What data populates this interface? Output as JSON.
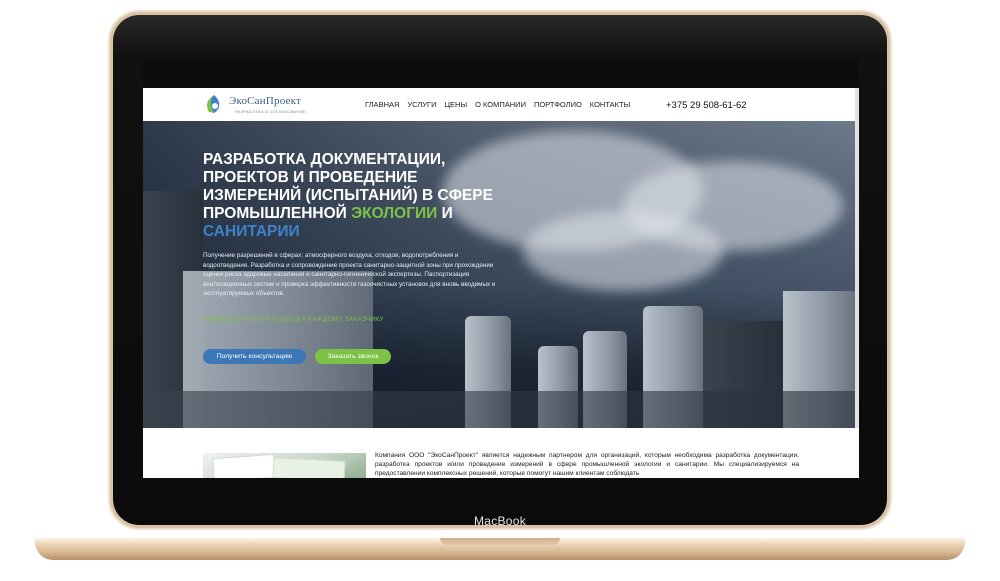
{
  "device": {
    "label": "MacBook"
  },
  "site": {
    "logo_text": "ЭкоСанПроект",
    "logo_sub": "РАЗРАБОТКА И СОГЛАСОВАНИЕ",
    "nav": [
      "ГЛАВНАЯ",
      "УСЛУГИ",
      "ЦЕНЫ",
      "О КОМПАНИИ",
      "ПОРТФОЛИО",
      "КОНТАКТЫ"
    ],
    "phone": "+375 29 508-61-62"
  },
  "hero": {
    "title_part1": "РАЗРАБОТКА ДОКУМЕНТАЦИИ, ПРОЕКТОВ И ПРОВЕДЕНИЕ ИЗМЕРЕНИЙ (ИСПЫТАНИЙ) В СФЕРЕ ПРОМЫШЛЕННОЙ ",
    "title_green": "ЭКОЛОГИИ",
    "title_and": " И ",
    "title_blue": "САНИТАРИИ",
    "description": "Получение разрешений в сферах: атмосферного воздуха, отходов, водопотребления и водоотведения. Разработка и сопровождение проекта санитарно-защитной зоны при прохождении оценки риска здоровью населения и санитарно-гигиенической экспертизы. Паспортизация вентиляционных систем и проверка эффективности газоочистных установок для вновь вводимых и эксплуатируемых объектов.",
    "tagline": "ИНДИВИДУАЛЬНЫЙ ПОДХОД К КАЖДОМУ ЗАКАЗЧИКУ",
    "btn_consult": "Получить консультацию",
    "btn_call": "Заказать звонок"
  },
  "about": {
    "text": "Компания ООО \"ЭкоСанПроект\" является надежным партнером для организаций, которым необходима разработка документации, разработка проектов и/или проведение измерений в сфере промышленной экологии и санитарии. Мы специализируемся на предоставлении комплексных решений, которые помогут нашим клиентам соблюдать"
  },
  "colors": {
    "accent_green": "#7cc246",
    "accent_blue": "#3c78b8",
    "logo_blue": "#3a5e8c"
  }
}
